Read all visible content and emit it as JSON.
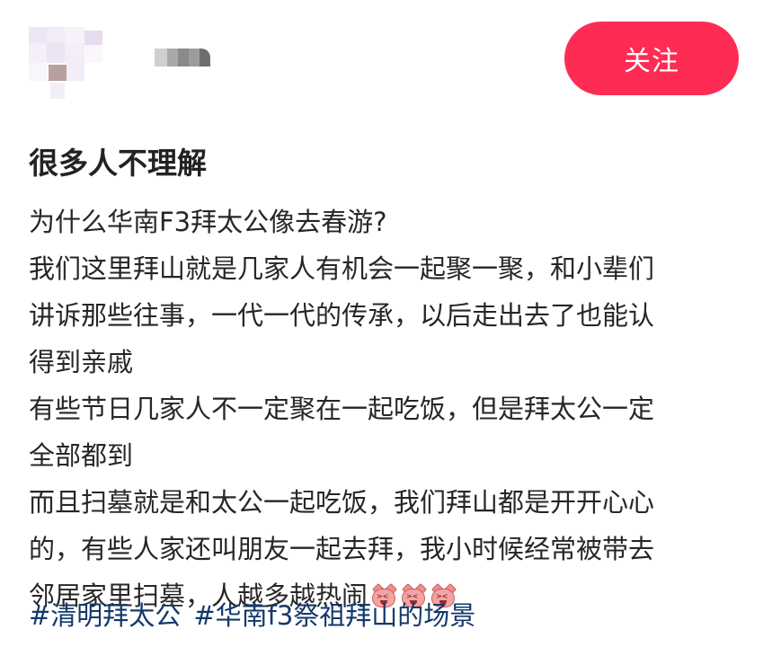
{
  "header": {
    "follow_label": "关注"
  },
  "post": {
    "title": "很多人不理解",
    "lines": [
      "为什么华南F3拜太公像去春游?",
      "我们这里拜山就是几家人有机会一起聚一聚，和小辈们",
      "讲诉那些往事，一代一代的传承，以后走出去了也能认",
      "得到亲戚",
      "有些节日几家人不一定聚在一起吃饭，但是拜太公一定",
      "全部都到",
      "而且扫墓就是和太公一起吃饭，我们拜山都是开开心心",
      "的，有些人家还叫朋友一起去拜，我小时候经常被带去",
      "邻居家里扫墓，人越多越热闹"
    ],
    "emojis": [
      "pig-face-emoji",
      "pig-face-emoji",
      "pig-face-emoji"
    ],
    "hashtags": [
      "#清明拜太公",
      "#华南f3祭祖拜山的场景"
    ]
  },
  "colors": {
    "follow_button": "#fe2c55",
    "hashtag": "#13386c",
    "text": "#262626"
  }
}
